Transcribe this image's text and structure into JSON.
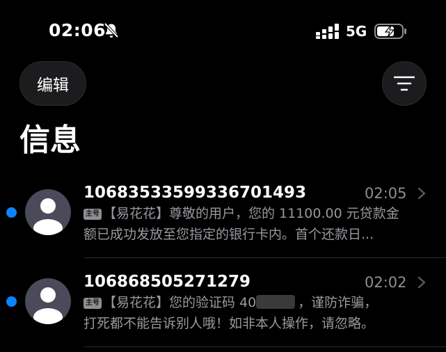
{
  "status_bar": {
    "time": "02:06",
    "network": "5G",
    "icons": [
      "bell-slash-icon",
      "signal-icon",
      "battery-charging-icon"
    ]
  },
  "header": {
    "edit_label": "编辑",
    "filter_icon": "filter-lines-icon",
    "title": "信息"
  },
  "messages": [
    {
      "sender": "10683533599336701493",
      "time": "02:05",
      "badge": "主号",
      "preview_line1": "【易花花】尊敬的用户，您的 11100.00 元贷款金",
      "preview_line2": "额已成功发放至您指定的银行卡内。首个还款日...",
      "unread": true
    },
    {
      "sender": "106868505271279",
      "time": "02:02",
      "badge": "主号",
      "preview_line1_before": "【易花花】您的验证码 40",
      "preview_line1_after": "，谨防诈骗，",
      "preview_line2": "打死都不能告诉别人哦！如非本人操作，请忽略。",
      "unread": true
    }
  ],
  "colors": {
    "background": "#000000",
    "unread_dot": "#0a84ff",
    "secondary_text": "#98989f",
    "button_bg": "#1c1c1e"
  }
}
